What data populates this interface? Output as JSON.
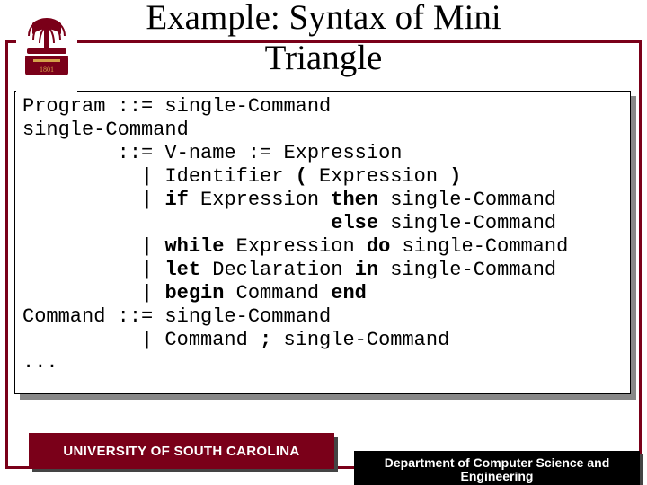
{
  "title_line1": "Example: Syntax of Mini",
  "title_line2": "Triangle",
  "code": {
    "l1a": "Program ::= single-Command",
    "l2a": "single-Command",
    "l3a": "        ::= V-name := Expression",
    "l4a": "          | Identifier ",
    "l4b": "(",
    "l4c": " Expression ",
    "l4d": ")",
    "l5a": "          | ",
    "l5b": "if",
    "l5c": " Expression ",
    "l5d": "then",
    "l5e": " single-Command",
    "l6a": "                          ",
    "l6b": "else",
    "l6c": " single-Command",
    "l7a": "          | ",
    "l7b": "while",
    "l7c": " Expression ",
    "l7d": "do",
    "l7e": " single-Command",
    "l8a": "          | ",
    "l8b": "let",
    "l8c": " Declaration ",
    "l8d": "in",
    "l8e": " single-Command",
    "l9a": "          | ",
    "l9b": "begin",
    "l9c": " Command ",
    "l9d": "end",
    "l10a": "Command ::= single-Command",
    "l11a": "          | Command ",
    "l11b": ";",
    "l11c": " single-Command",
    "l12a": "..."
  },
  "footer_left": "UNIVERSITY OF SOUTH CAROLINA",
  "footer_right_line1": "Department of Computer Science and",
  "footer_right_line2": "Engineering"
}
